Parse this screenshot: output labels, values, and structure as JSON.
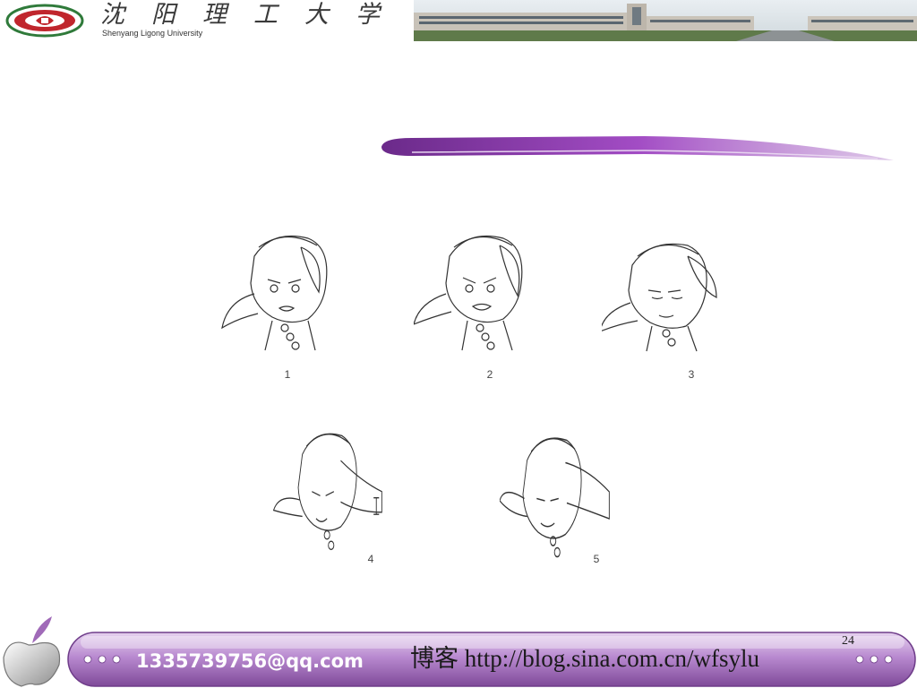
{
  "header": {
    "university_name": "沈阳理工大学",
    "university_name_en": "Shenyang Ligong University"
  },
  "figure": {
    "labels": [
      "1",
      "2",
      "3",
      "4",
      "5"
    ]
  },
  "footer": {
    "email": "1335739756@qq.com",
    "blog": "博客 http://blog.sina.com.cn/wfsylu",
    "slide_number": "24"
  },
  "colors": {
    "accent_purple": "#8a3aa8",
    "footer_pill": "#b98ad0",
    "logo_red": "#c0262d",
    "logo_green": "#2f7a3a"
  }
}
